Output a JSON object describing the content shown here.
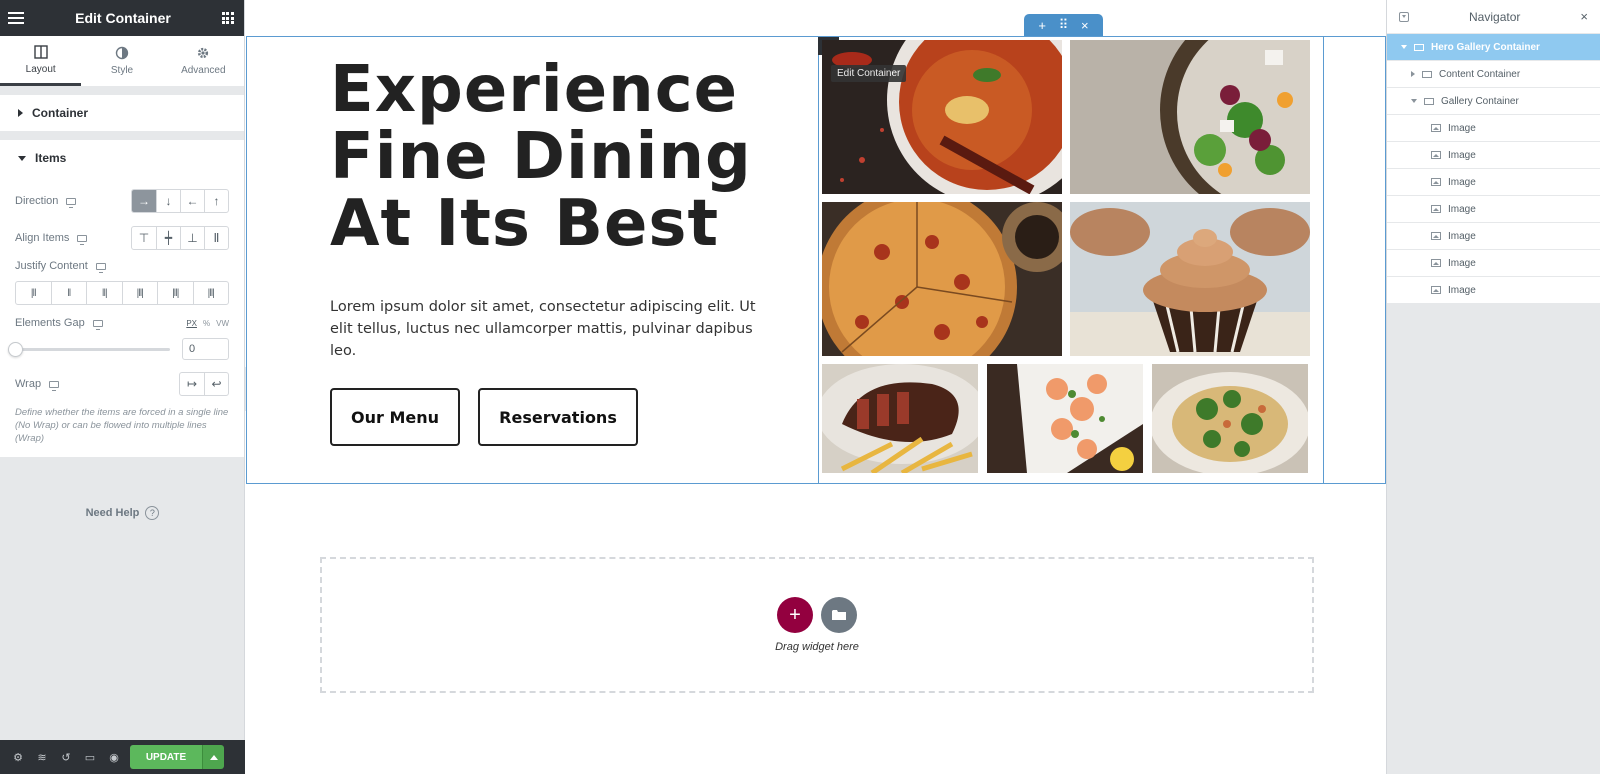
{
  "panel": {
    "title": "Edit Container",
    "tabs": [
      {
        "label": "Layout"
      },
      {
        "label": "Style"
      },
      {
        "label": "Advanced"
      }
    ],
    "sections": {
      "container": "Container",
      "items": "Items"
    },
    "controls": {
      "direction": "Direction",
      "align_items": "Align Items",
      "justify_content": "Justify Content",
      "elements_gap": "Elements Gap",
      "gap_units": [
        "PX",
        "%",
        "VW"
      ],
      "gap_value": "0",
      "wrap": "Wrap",
      "wrap_help": "Define whether the items are forced in a single line (No Wrap) or can be flowed into multiple lines (Wrap)"
    },
    "need_help": "Need Help",
    "update_label": "UPDATE"
  },
  "canvas": {
    "heading": "Experience\nFine Dining\nAt Its Best",
    "paragraph": "Lorem ipsum dolor sit amet, consectetur adipiscing elit. Ut elit tellus, luctus nec ullamcorper mattis, pulvinar dapibus leo.",
    "buttons": {
      "menu": "Our Menu",
      "reservations": "Reservations"
    },
    "edit_tooltip": "Edit Container",
    "drop_text": "Drag widget here",
    "images": [
      "curry",
      "salad",
      "pizza",
      "cupcake",
      "steak-fries",
      "shrimp",
      "pasta-broccoli"
    ]
  },
  "navigator": {
    "title": "Navigator",
    "items": [
      {
        "label": "Hero Gallery Container"
      },
      {
        "label": "Content Container"
      },
      {
        "label": "Gallery Container"
      },
      {
        "label": "Image"
      },
      {
        "label": "Image"
      },
      {
        "label": "Image"
      },
      {
        "label": "Image"
      },
      {
        "label": "Image"
      },
      {
        "label": "Image"
      },
      {
        "label": "Image"
      }
    ]
  },
  "colors": {
    "accent": "#93003f",
    "update": "#5cb85c",
    "selection": "#8fc9f0",
    "frame": "#5b9bd1"
  }
}
